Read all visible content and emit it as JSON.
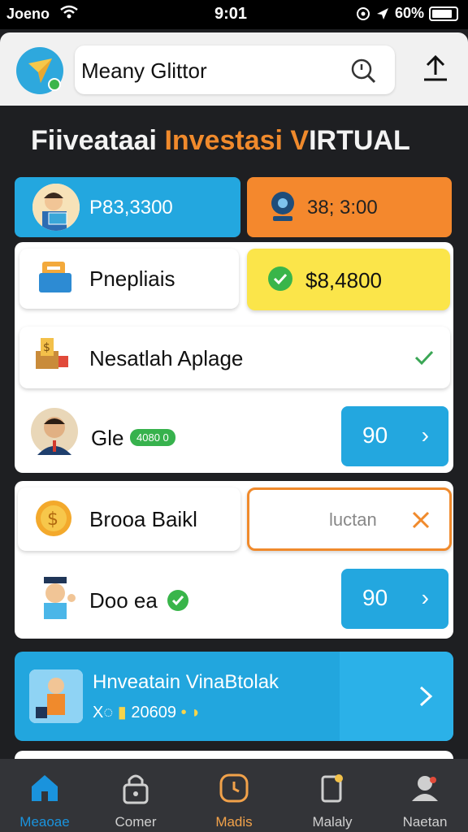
{
  "status_bar": {
    "carrier": "Joeno",
    "time": "9:01",
    "battery": "60%"
  },
  "header": {
    "search_value": "Meany Glittor"
  },
  "page": {
    "title_part1": "Fiiveataai",
    "title_part2": "Investasi V",
    "title_part3": "IRTUAL"
  },
  "balances": [
    {
      "amount": "P83,3300"
    },
    {
      "amount": "38; 3:00"
    }
  ],
  "panel1": {
    "row1": {
      "label": "Pnepliais",
      "chip_value": "$8,4800"
    },
    "row2": {
      "label": "Nesatlah Aplage"
    },
    "row3": {
      "label": "Gle",
      "badge": "4080 0",
      "button_value": "90"
    }
  },
  "panel2": {
    "row1": {
      "label": "Brooa Baikl",
      "input_value": "luctan"
    },
    "row2": {
      "label": "Doo ea",
      "button_value": "90"
    }
  },
  "banner": {
    "title": "Hnveatain VinaBtolak",
    "subtitle_prefix": "X◌",
    "amount": "20609"
  },
  "nav": [
    {
      "label": "Meaoae",
      "icon": "home-icon"
    },
    {
      "label": "Comer",
      "icon": "lock-icon"
    },
    {
      "label": "Madis",
      "icon": "clock-icon"
    },
    {
      "label": "Malaly",
      "icon": "clipboard-icon"
    },
    {
      "label": "Naetan",
      "icon": "user-icon"
    }
  ],
  "colors": {
    "accent_blue": "#23a7df",
    "accent_orange": "#f4882d",
    "highlight_yellow": "#fbe54a",
    "success_green": "#37b24d"
  }
}
